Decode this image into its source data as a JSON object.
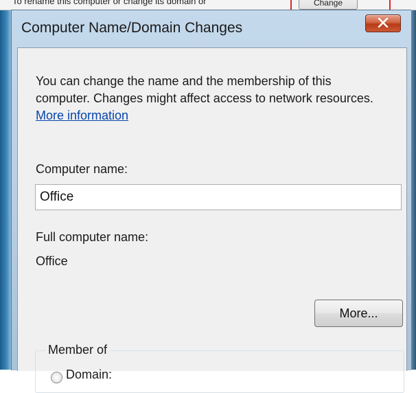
{
  "background": {
    "text": "To rename this computer or change its domain or",
    "button_label": "Change"
  },
  "dialog": {
    "title": "Computer Name/Domain Changes",
    "close_label": "X",
    "intro_line1": "You can change the name and the membership of this",
    "intro_line2": "computer. Changes might affect access to network resources.",
    "more_info_link": "More information",
    "computer_name_label": "Computer name:",
    "computer_name_value": "Office",
    "full_name_label": "Full computer name:",
    "full_name_value": "Office",
    "more_button": "More...",
    "member_of_label": "Member of",
    "domain_label": "Domain:"
  },
  "colors": {
    "link": "#0645ad",
    "close_button": "#c9542f",
    "frame": "#b6cde3"
  }
}
